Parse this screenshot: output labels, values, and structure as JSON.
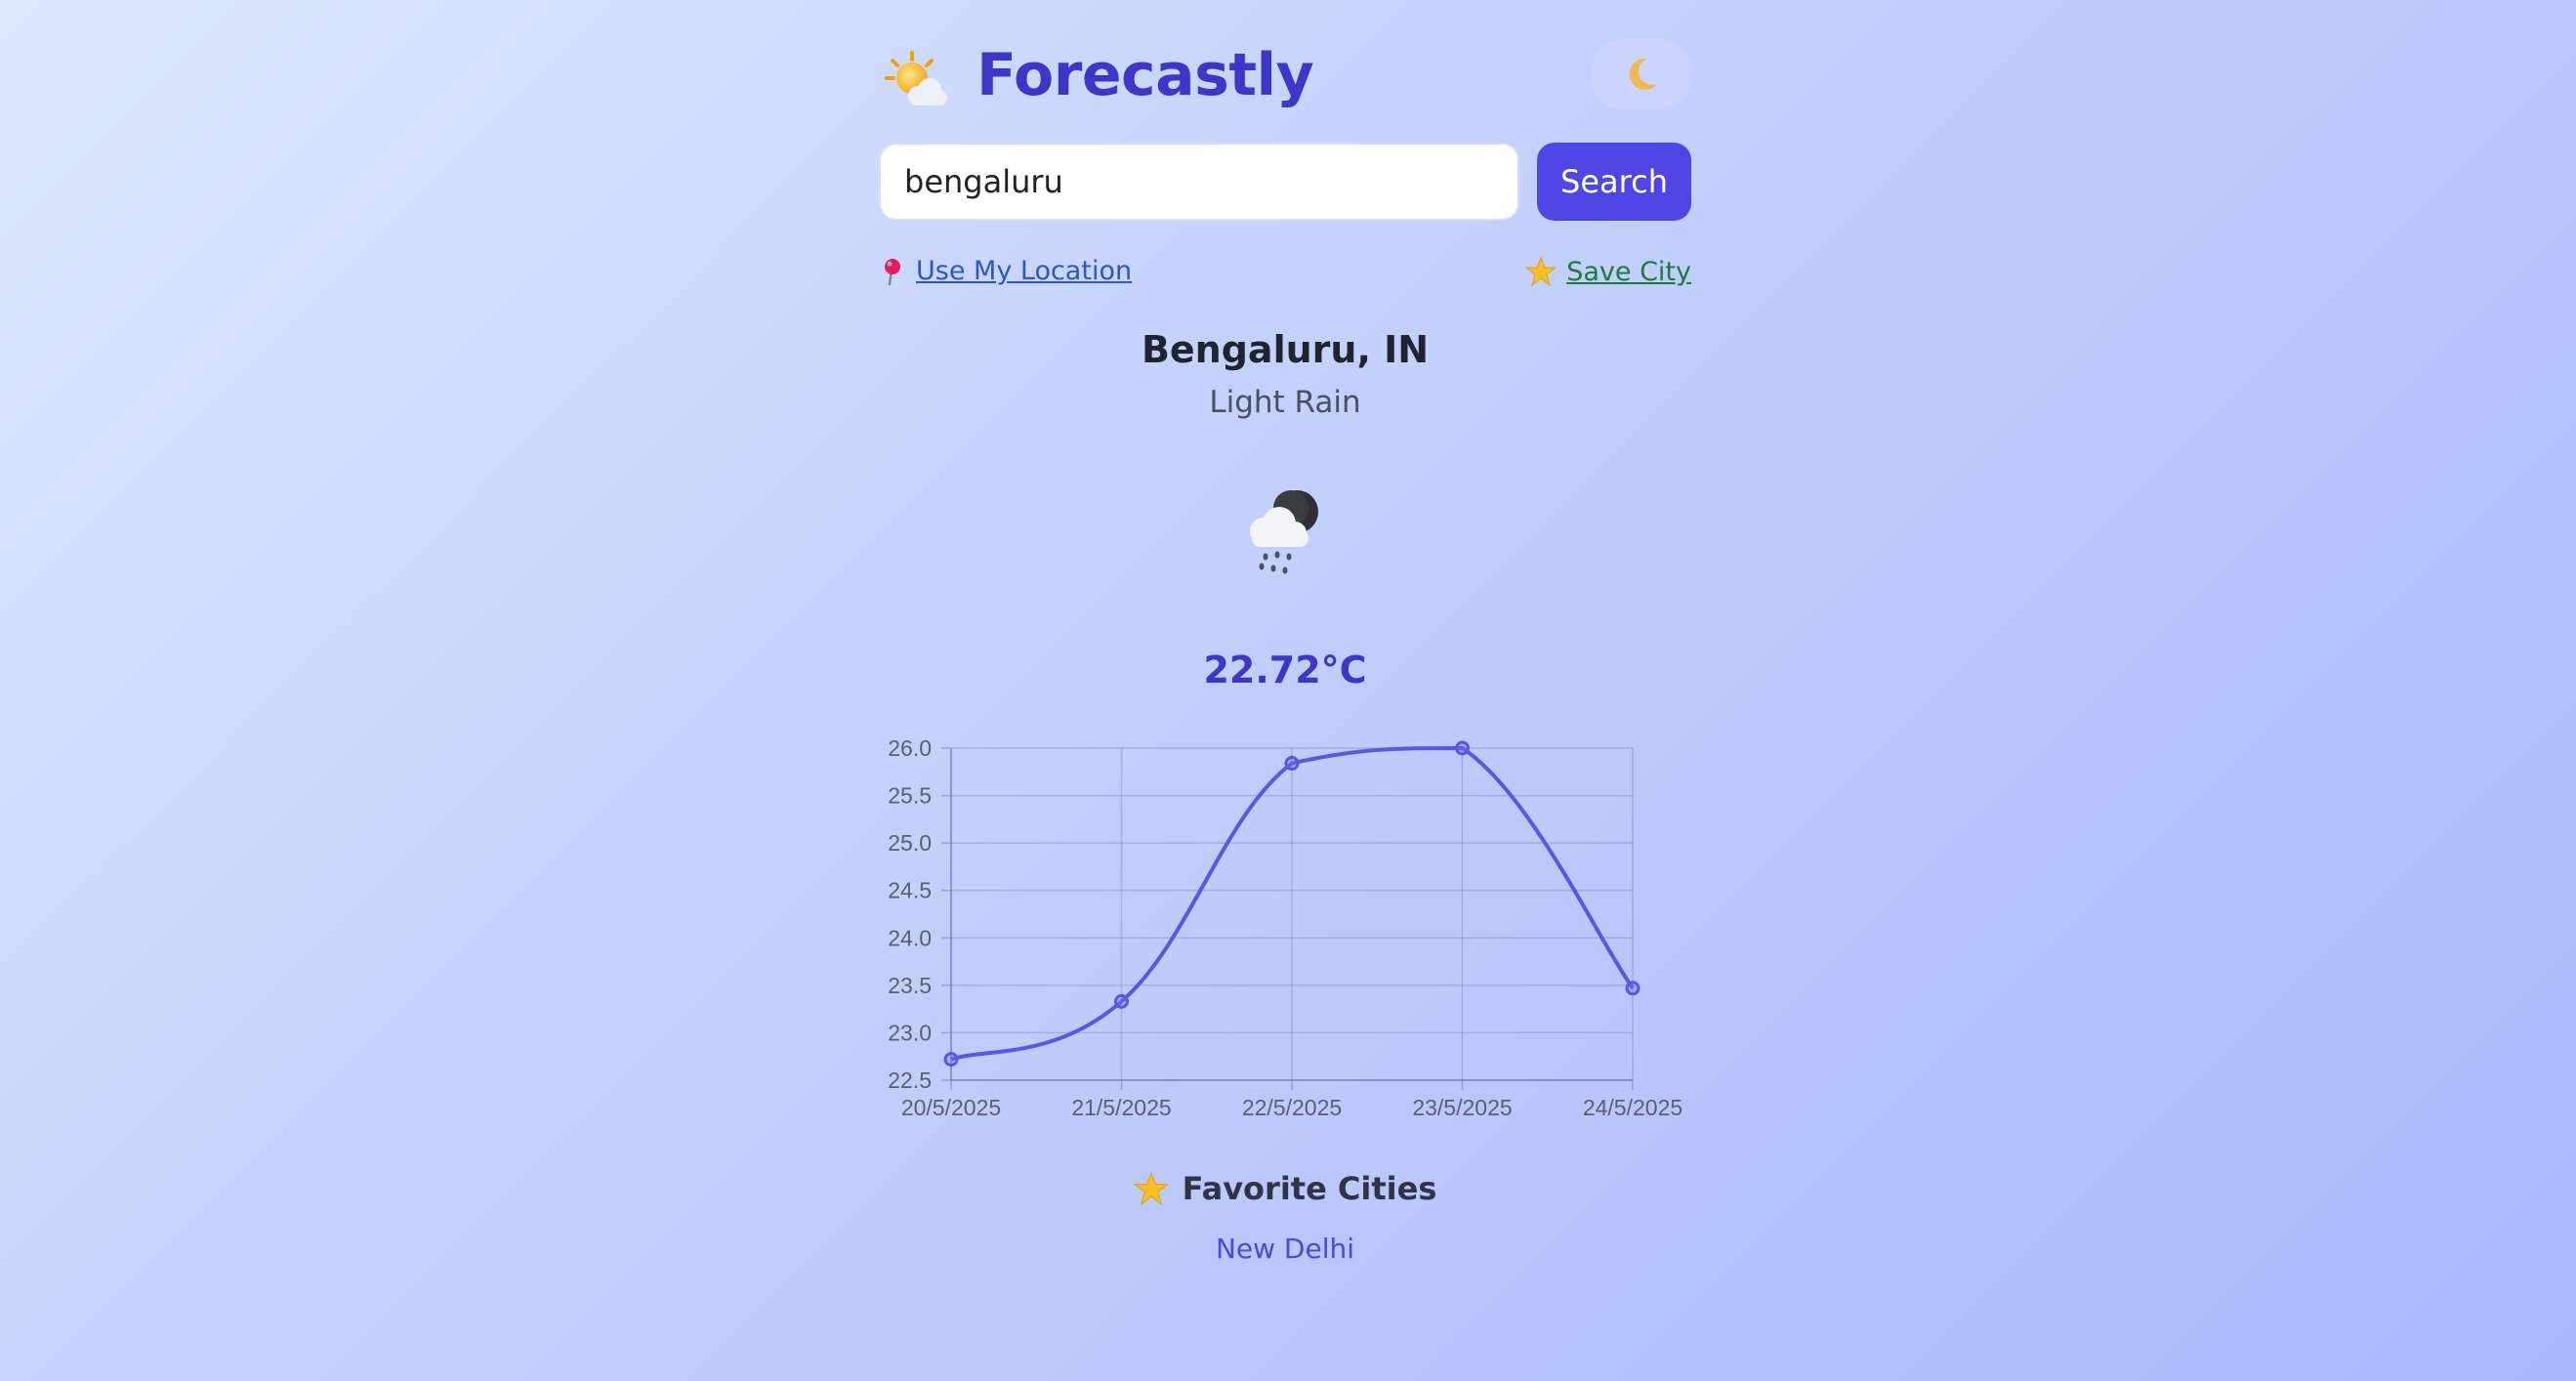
{
  "header": {
    "title": "Forecastly",
    "logo_icon": "sun-behind-cloud-icon",
    "theme_toggle_icon": "crescent-moon-icon"
  },
  "search": {
    "value": "bengaluru",
    "placeholder": "",
    "button_label": "Search"
  },
  "links": {
    "use_location": "Use My Location",
    "save_city": "Save City"
  },
  "weather": {
    "city": "Bengaluru, IN",
    "condition": "Light Rain",
    "icon": "rain-cloud-night-icon",
    "temperature": "22.72°C"
  },
  "colors": {
    "accent": "#4f46e5",
    "title": "#3f35c9",
    "line": "#5b56e6"
  },
  "chart_data": {
    "type": "line",
    "x": [
      "20/5/2025",
      "21/5/2025",
      "22/5/2025",
      "23/5/2025",
      "24/5/2025"
    ],
    "series": [
      {
        "values": [
          22.72,
          23.33,
          25.84,
          26.0,
          23.47
        ]
      }
    ],
    "ylim": [
      22.5,
      26.0
    ],
    "yticks": [
      "26.0",
      "25.5",
      "25.0",
      "24.5",
      "24.0",
      "23.5",
      "23.0",
      "22.5"
    ],
    "grid": true,
    "legend": "none"
  },
  "favorites": {
    "title": "Favorite Cities",
    "items": [
      "New Delhi"
    ]
  }
}
